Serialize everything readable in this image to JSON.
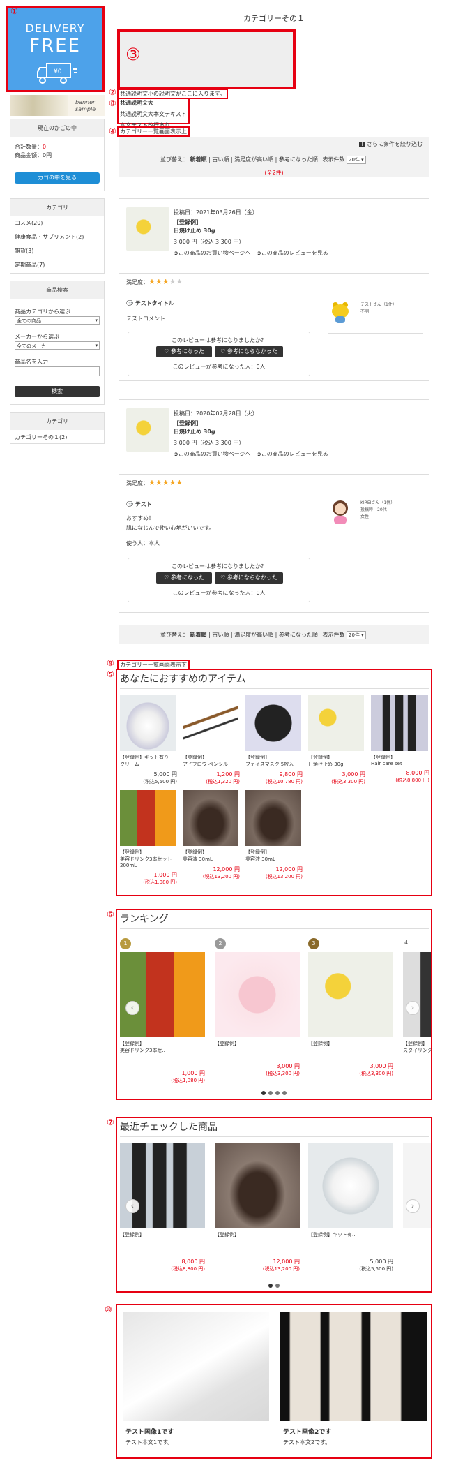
{
  "banner": {
    "line1": "DELIVERY",
    "line2": "FREE",
    "small_label_a": "banner",
    "small_label_b": "sample"
  },
  "annotations": {
    "n1": "①",
    "n2": "②",
    "n3": "③",
    "n4": "④",
    "n5": "⑤",
    "n6": "⑥",
    "n7": "⑦",
    "n8": "⑧",
    "n9": "⑨",
    "n10": "⑩"
  },
  "page": {
    "title": "カテゴリーその１"
  },
  "freearea": {
    "line_small": "共通説明文小の説明文がここに入ります。",
    "heading": "共通説明文大",
    "body1": "共通説明文大本文テキスト",
    "body2": "本文テスト改行あり",
    "top_label": "カテゴリー一覧画面表示上",
    "bottom_label": "カテゴリー一覧画面表示下"
  },
  "cart": {
    "title": "現在のかごの中",
    "count_label": "合計数量：",
    "count": "0",
    "amount_label": "商品金額：",
    "amount": "0円",
    "button": "カゴの中を見る"
  },
  "categories": {
    "title": "カテゴリ",
    "items": [
      "コスメ(20)",
      "健康食品・サプリメント(2)",
      "雑貨(3)",
      "定期商品(7)"
    ]
  },
  "search": {
    "title": "商品検索",
    "cat_label": "商品カテゴリから選ぶ",
    "cat_value": "全ての商品",
    "maker_label": "メーカーから選ぶ",
    "maker_value": "全てのメーカー",
    "name_label": "商品名を入力",
    "button": "検索"
  },
  "categories2": {
    "title": "カテゴリ",
    "item": "カテゴリーその１(2)"
  },
  "filter": {
    "label": "さらに条件を絞り込む"
  },
  "sort": {
    "label": "並び替え：",
    "options": [
      "新着順",
      "古い順",
      "満足度が高い順",
      "参考になった順"
    ],
    "count_label": "表示件数",
    "count_value": "20件",
    "total": "(全2件)"
  },
  "reviews": [
    {
      "date": "投稿日：2021年03月26日（金）",
      "tag": "【登録例】",
      "product": "日焼け止め 30g",
      "price": "3,000 円（税込 3,300 円）",
      "link1": "この商品のお買い物ページへ",
      "link2": "この商品のレビューを見る",
      "rating_label": "満足度：",
      "rating": 3,
      "title": "テストタイトル",
      "comment": "テストコメント",
      "comment2": "",
      "comment3": "",
      "helpful_q": "このレビューは参考になりましたか？",
      "btn_yes": "♡ 参考になった",
      "btn_no": "♡ 参考にならなかった",
      "helpful_count_label": "このレビューが参考になった人：",
      "helpful_count": "0人",
      "reviewer": "テストさん（1件）",
      "reviewer_meta1": "不明",
      "reviewer_meta2": ""
    },
    {
      "date": "投稿日：2020年07月28日（火）",
      "tag": "【登録例】",
      "product": "日焼け止め 30g",
      "price": "3,000 円（税込 3,300 円）",
      "link1": "この商品のお買い物ページへ",
      "link2": "この商品のレビューを見る",
      "rating_label": "満足度：",
      "rating": 5,
      "title": "テスト",
      "comment": "おすすめ！",
      "comment2": "肌になじんで使い心地がいいです。",
      "comment3": "使う人：本人",
      "helpful_q": "このレビューは参考になりましたか？",
      "btn_yes": "♡ 参考になった",
      "btn_no": "♡ 参考にならなかった",
      "helpful_count_label": "このレビューが参考になった人：",
      "helpful_count": "0人",
      "reviewer": "KIREIさん（1件）",
      "reviewer_meta1": "投稿時：20代",
      "reviewer_meta2": "女性"
    }
  ],
  "recommend": {
    "title": "あなたにおすすめのアイテム",
    "items": [
      {
        "name1": "【登録例】キット有り",
        "name2": "クリーム",
        "price": "5,000 円",
        "tax": "(税込5,500 円)",
        "red": false
      },
      {
        "name1": "【登録例】",
        "name2": "アイブロウ ペンシル",
        "price": "1,200 円",
        "tax": "(税込1,320 円)",
        "red": true
      },
      {
        "name1": "【登録例】",
        "name2": "フェイスマスク 5枚入",
        "price": "9,800 円",
        "tax": "(税込10,780 円)",
        "red": true
      },
      {
        "name1": "【登録例】",
        "name2": "日焼け止め 30g",
        "price": "3,000 円",
        "tax": "(税込3,300 円)",
        "red": true
      },
      {
        "name1": "【登録例】",
        "name2": "Hair care set",
        "price": "8,000 円",
        "tax": "(税込8,800 円)",
        "red": true
      },
      {
        "name1": "【登録例】",
        "name2": "美容ドリンク3本セット 200mL",
        "price": "1,000 円",
        "tax": "(税込1,080 円)",
        "red": true
      },
      {
        "name1": "【登録例】",
        "name2": "美容液 30mL",
        "price": "12,000 円",
        "tax": "(税込13,200 円)",
        "red": true
      },
      {
        "name1": "【登録例】",
        "name2": "美容液 30mL",
        "price": "12,000 円",
        "tax": "(税込13,200 円)",
        "red": true
      }
    ]
  },
  "ranking": {
    "title": "ランキング",
    "items": [
      {
        "rank": "1",
        "name1": "【登録例】",
        "name2": "美容ドリンク3本セ..",
        "price": "1,000 円",
        "tax": "(税込1,080 円)"
      },
      {
        "rank": "2",
        "name1": "【登録例】",
        "name2": "",
        "price": "3,000 円",
        "tax": "(税込3,300 円)"
      },
      {
        "rank": "3",
        "name1": "【登録例】",
        "name2": "",
        "price": "3,000 円",
        "tax": "(税込3,300 円)"
      },
      {
        "rank": "4",
        "name1": "【登録例】",
        "name2": "スタイリング",
        "price": "",
        "tax": ""
      }
    ]
  },
  "recent": {
    "title": "最近チェックした商品",
    "items": [
      {
        "name1": "【登録例】",
        "price": "8,000 円",
        "tax": "(税込8,800 円)",
        "red": true
      },
      {
        "name1": "【登録例】",
        "price": "12,000 円",
        "tax": "(税込13,200 円)",
        "red": true
      },
      {
        "name1": "【登録例】キット有..",
        "price": "5,000 円",
        "tax": "(税込5,500 円)",
        "red": false
      },
      {
        "name1": "...",
        "price": "",
        "tax": "",
        "red": false
      }
    ]
  },
  "bottom_banners": [
    {
      "title": "テスト画像1です",
      "text": "テスト本文1です。"
    },
    {
      "title": "テスト画像2です",
      "text": "テスト本文2です。"
    }
  ],
  "colors": {
    "accent_blue": "#4aa3df",
    "banner_blue": "#4da2ea",
    "red": "#e60012",
    "star": "#f5a623"
  }
}
